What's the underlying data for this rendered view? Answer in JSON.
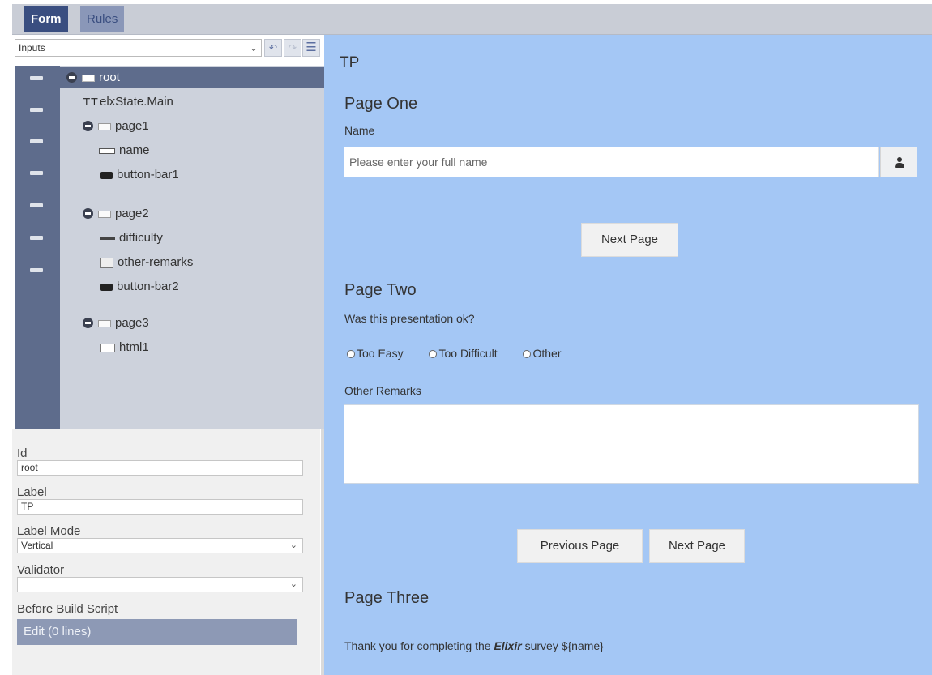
{
  "tabs": {
    "form": "Form",
    "rules": "Rules"
  },
  "toolbar": {
    "inputs_select": "Inputs",
    "undo_icon": "undo-icon",
    "redo_icon": "redo-icon",
    "menu_icon": "menu-icon"
  },
  "tree": {
    "root": "root",
    "state": "elxState.Main",
    "page1": "page1",
    "name": "name",
    "button_bar1": "button-bar1",
    "page2": "page2",
    "difficulty": "difficulty",
    "other_remarks": "other-remarks",
    "button_bar2": "button-bar2",
    "page3": "page3",
    "html1": "html1"
  },
  "props": {
    "id_label": "Id",
    "id_value": "root",
    "label_label": "Label",
    "label_value": "TP",
    "label_mode_label": "Label Mode",
    "label_mode_value": "Vertical",
    "validator_label": "Validator",
    "validator_value": "",
    "before_build_label": "Before Build Script",
    "edit_button": "Edit (0 lines)"
  },
  "preview": {
    "title": "TP",
    "page_one": {
      "heading": "Page One",
      "name_label": "Name",
      "name_placeholder": "Please enter your full name",
      "next": "Next Page"
    },
    "page_two": {
      "heading": "Page Two",
      "question": "Was this presentation ok?",
      "options": [
        "Too Easy",
        "Too Difficult",
        "Other"
      ],
      "remarks_label": "Other Remarks",
      "prev": "Previous Page",
      "next": "Next Page"
    },
    "page_three": {
      "heading": "Page Three",
      "thanks_before": "Thank you for completing the",
      "thanks_bold": "Elixir",
      "thanks_after": "survey ${name}"
    }
  },
  "colors": {
    "accent": "#3a4e80",
    "preview_bg": "#a4c7f5",
    "tree_bg": "#cdd2dc",
    "selected": "#5e6c8c"
  }
}
